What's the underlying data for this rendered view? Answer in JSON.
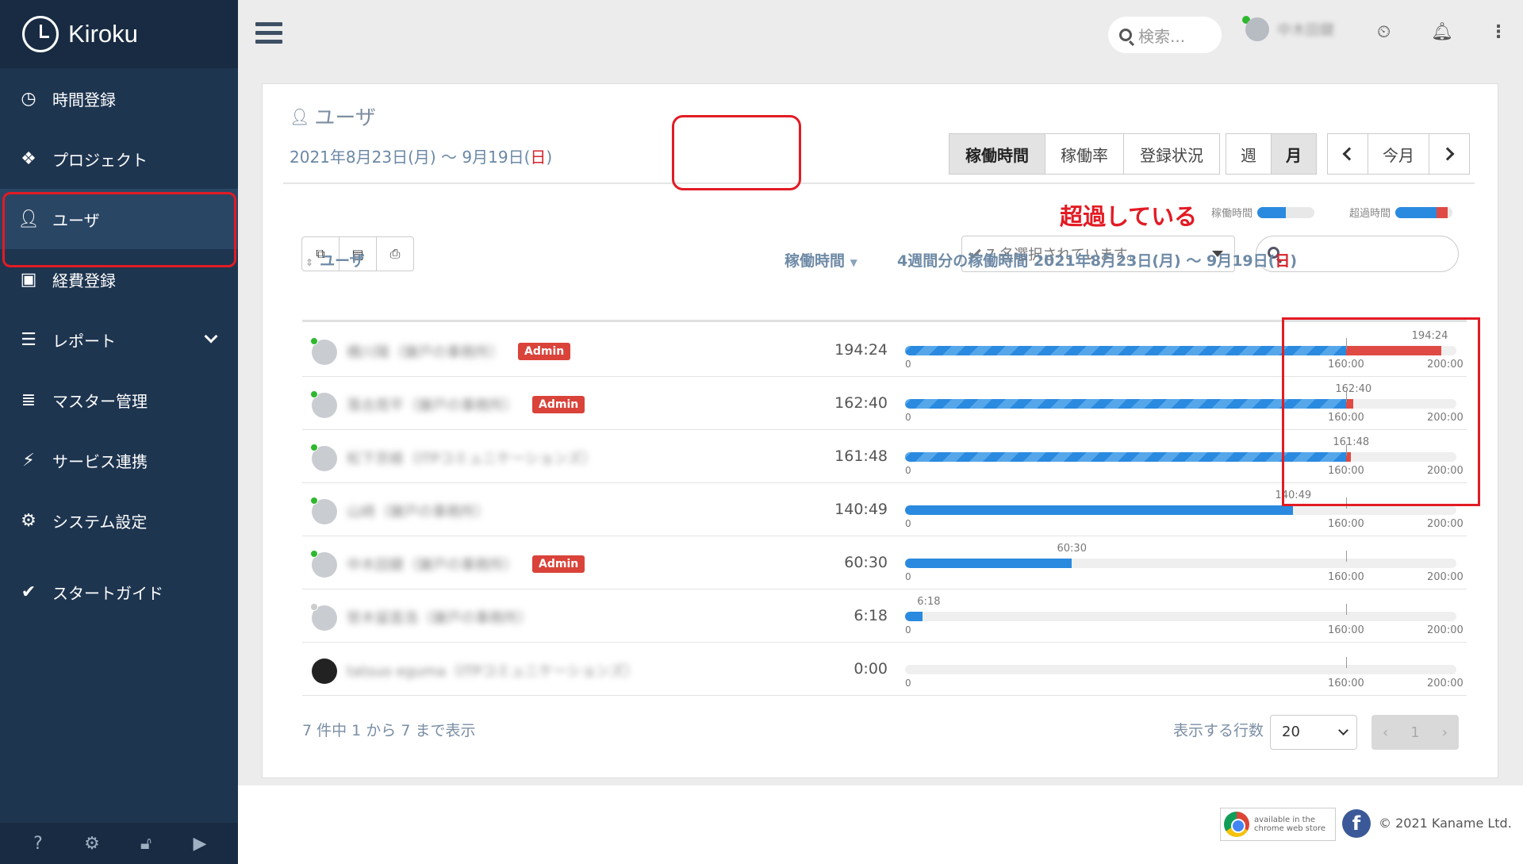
{
  "app": {
    "name": "Kiroku"
  },
  "sidebar": {
    "items": [
      {
        "label": "時間登録",
        "icon": "clock-icon"
      },
      {
        "label": "プロジェクト",
        "icon": "cubes-icon"
      },
      {
        "label": "ユーザ",
        "icon": "user-icon"
      },
      {
        "label": "経費登録",
        "icon": "train-icon"
      },
      {
        "label": "レポート",
        "icon": "list-icon"
      },
      {
        "label": "マスター管理",
        "icon": "database-icon"
      },
      {
        "label": "サービス連携",
        "icon": "plug-icon"
      },
      {
        "label": "システム設定",
        "icon": "gear-icon"
      },
      {
        "label": "スタートガイド",
        "icon": "check-icon"
      }
    ],
    "active": "ユーザ"
  },
  "topbar": {
    "search_placeholder": "検索...",
    "user_name": "中木田鍵"
  },
  "page": {
    "title": "ユーザ",
    "date_prefix": "2021年8月23日(月) 〜 9月19日(",
    "date_sun": "日",
    "date_suffix": ")"
  },
  "view_buttons": [
    "稼働時間",
    "稼働率",
    "登録状況"
  ],
  "active_view": "稼働時間",
  "period_buttons": [
    "週",
    "月"
  ],
  "active_period": "月",
  "nav": {
    "today": "今月"
  },
  "legend": {
    "work": "稼働時間",
    "over": "超過時間"
  },
  "filter": {
    "selected": "7 名選択されています。"
  },
  "table": {
    "headers": {
      "user": "ユーザ",
      "hours": "稼働時間",
      "chart_prefix": "4週間分の稼働時間 2021年8月23日(月) 〜 9月19日(",
      "chart_sun": "日",
      "chart_suffix": ")"
    },
    "rows": [
      {
        "name": "橋川陽（鎌戸の事務所）",
        "admin": "Admin",
        "hours": "194:24",
        "online": true
      },
      {
        "name": "落合周平（鎌戸の事務所）",
        "admin": "Admin",
        "hours": "162:40",
        "online": true
      },
      {
        "name": "松下京綾（ITPコミュニケーションズ）",
        "admin": "",
        "hours": "161:48",
        "online": true
      },
      {
        "name": "山崎（鎌戸の事務所）",
        "admin": "",
        "hours": "140:49",
        "online": true
      },
      {
        "name": "中木田鍵（鎌戸の事務所）",
        "admin": "Admin",
        "hours": "60:30",
        "online": true
      },
      {
        "name": "笹木留直浩（鎌戸の事務所）",
        "admin": "",
        "hours": "6:18",
        "online": false
      },
      {
        "name": "tatsuo eguma（ITPコミュニケーションズ）",
        "admin": "",
        "hours": "0:00",
        "online": false
      }
    ],
    "scale": {
      "zero": "0",
      "mark": "160:00",
      "max": "200:00"
    }
  },
  "annotation": "超過している",
  "pagination": {
    "info": "7 件中 1 から 7 まで表示",
    "rows_label": "表示する行数",
    "rows_value": "20",
    "current_page": "1",
    "prev": "‹",
    "next": "›"
  },
  "footer": {
    "chrome_store_line1": "available in the",
    "chrome_store_line2": "chrome web store",
    "facebook": "f",
    "copyright": "© 2021 Kaname Ltd."
  },
  "colors": {
    "sidebar": "#1e3550",
    "highlight": "#e21b24",
    "bar_blue": "#2a8adf",
    "bar_over": "#df4a44",
    "admin_badge": "#d9433a"
  },
  "chart_data": {
    "type": "bar",
    "categories": [
      "橋川陽（鎌戸の事務所）",
      "落合周平（鎌戸の事務所）",
      "松下京綾（ITPコミュニケーションズ）",
      "山崎（鎌戸の事務所）",
      "中木田鍵（鎌戸の事務所）",
      "笹木留直浩（鎌戸の事務所）",
      "tatsuo eguma（ITPコミュニケーションズ）"
    ],
    "values_hours": [
      194.4,
      162.667,
      161.8,
      140.817,
      60.5,
      6.3,
      0
    ],
    "labels": [
      "194:24",
      "162:40",
      "161:48",
      "140:49",
      "60:30",
      "6:18",
      ""
    ],
    "threshold": 160,
    "xlim": [
      0,
      200
    ]
  }
}
